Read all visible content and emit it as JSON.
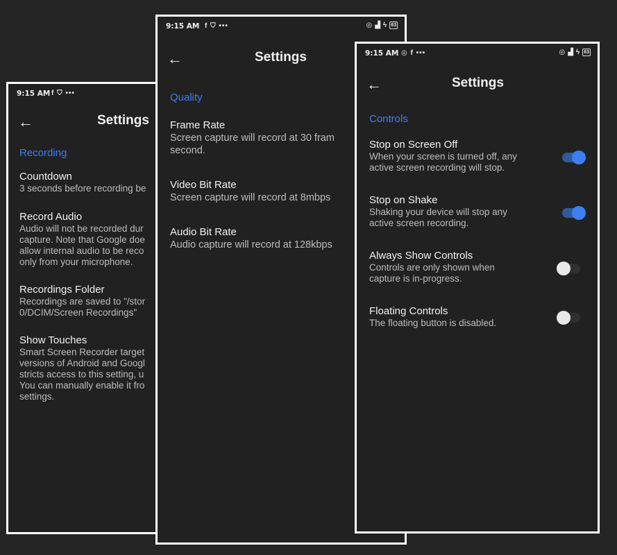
{
  "phones": [
    {
      "status": {
        "time": "9:15 AM",
        "icons": "f ⛉ •••"
      },
      "title": "Settings",
      "section": "Recording",
      "items": [
        {
          "name": "Countdown",
          "desc": "3 seconds before recording be"
        },
        {
          "name": "Record Audio",
          "desc": "Audio will not be recorded dur\ncapture. Note that Google doe\nallow internal audio to be reco\nonly from your microphone."
        },
        {
          "name": "Recordings Folder",
          "desc": "Recordings are saved to \"/stor\n0/DCIM/Screen Recordings\""
        },
        {
          "name": "Show Touches",
          "desc": "Smart Screen Recorder target\nversions of Android and Googl\nstricts access to this setting, u\nYou can manually enable it fro\nsettings."
        }
      ]
    },
    {
      "status": {
        "time": "9:15 AM",
        "icons": "f ⛉ •••",
        "right": "63"
      },
      "title": "Settings",
      "section": "Quality",
      "items": [
        {
          "name": "Frame Rate",
          "desc": "Screen capture will record at 30 fram\nsecond."
        },
        {
          "name": "Video Bit Rate",
          "desc": "Screen capture will record at 8mbps"
        },
        {
          "name": "Audio Bit Rate",
          "desc": "Audio capture will record at 128kbps"
        }
      ]
    },
    {
      "status": {
        "time": "9:15 AM",
        "icons": "◎ f •••",
        "right": "63"
      },
      "title": "Settings",
      "section": "Controls",
      "items": [
        {
          "name": "Stop on Screen Off",
          "desc": "When your screen is turned off, any\nactive screen recording will stop.",
          "toggle": true
        },
        {
          "name": "Stop on Shake",
          "desc": "Shaking your device will stop any\nactive screen recording.",
          "toggle": true
        },
        {
          "name": "Always Show Controls",
          "desc": "Controls are only shown when\ncapture is in-progress.",
          "toggle": false
        },
        {
          "name": "Floating Controls",
          "desc": "The floating button is disabled.",
          "toggle": false
        }
      ]
    }
  ],
  "icons": {
    "back": "arrow-left-icon"
  },
  "colors": {
    "accent": "#3d7ff0",
    "background": "#212121",
    "toggle_on": "#3d7ff0"
  }
}
